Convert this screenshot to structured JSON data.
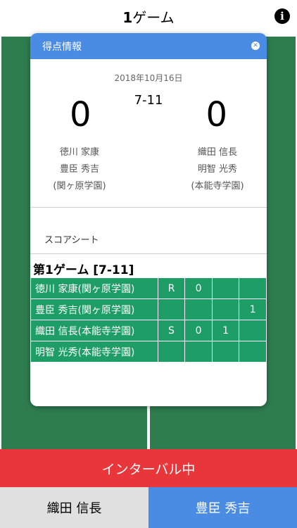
{
  "header": {
    "title_num": "1",
    "title_rest": "ゲーム",
    "info_icon": "info-icon"
  },
  "modal": {
    "header_label": "得点情報",
    "date": "2018年10月16日",
    "game_score": "7-11",
    "score_left": "0",
    "score_right": "0",
    "team_left": [
      "徳川 家康",
      "豊臣 秀吉",
      "(関ヶ原学園)"
    ],
    "team_right": [
      "織田 信長",
      "明智 光秀",
      "(本能寺学園)"
    ],
    "sheet_label": "スコアシート",
    "game_title_num": "1",
    "game_title_pre": "第",
    "game_title_post": "ゲーム [7-11]",
    "rows": [
      {
        "name": "徳川 家康(関ヶ原学園)",
        "cells": [
          "R",
          "0",
          "",
          ""
        ]
      },
      {
        "name": "豊臣 秀吉(関ヶ原学園)",
        "cells": [
          "",
          "",
          "",
          "1"
        ]
      },
      {
        "name": "織田 信長(本能寺学園)",
        "cells": [
          "S",
          "0",
          "1",
          ""
        ]
      },
      {
        "name": "明智 光秀(本能寺学園)",
        "cells": [
          "",
          "",
          "",
          ""
        ]
      }
    ]
  },
  "interval_label": "インターバル中",
  "bottom": {
    "left_label": "織田 信長",
    "right_label": "豊臣 秀吉"
  },
  "colors": {
    "accent_blue": "#4a8be3",
    "court_green": "#2e7d4f",
    "interval_red": "#e8363a"
  }
}
